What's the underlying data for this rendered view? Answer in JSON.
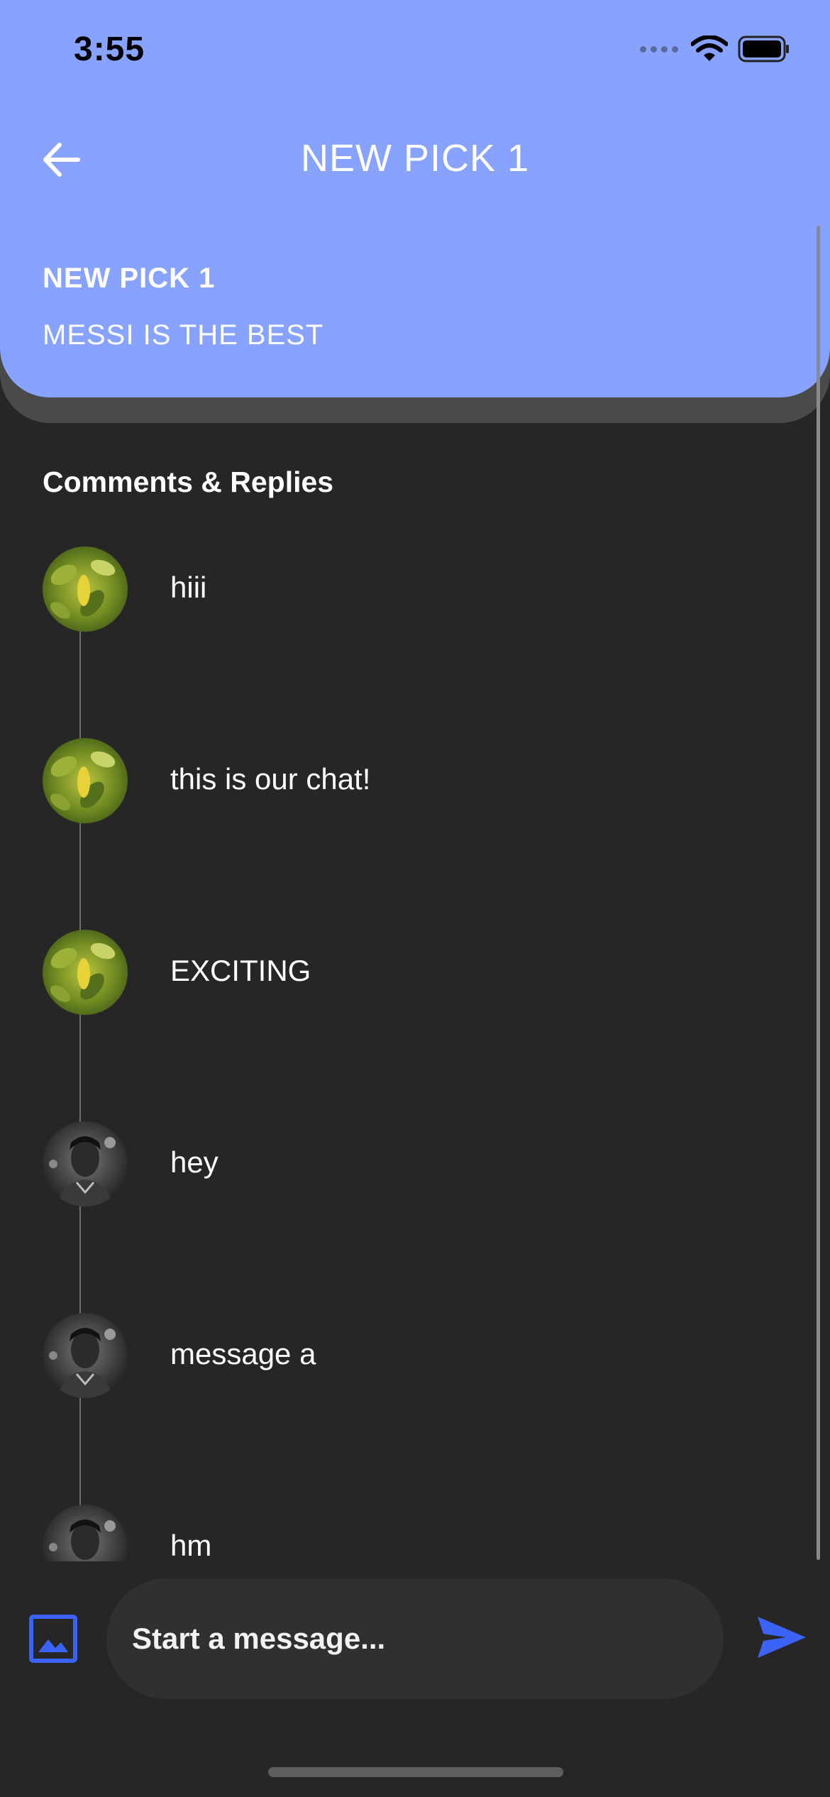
{
  "status_bar": {
    "time": "3:55"
  },
  "header": {
    "title": "NEW PICK 1",
    "pick_name": "NEW PICK 1",
    "pick_description": "MESSI IS THE BEST",
    "background_color": "#88a3ff"
  },
  "comments_section": {
    "title": "Comments & Replies",
    "comments": [
      {
        "text": "hiii",
        "avatar": "leaf-avatar"
      },
      {
        "text": "this is our chat!",
        "avatar": "leaf-avatar"
      },
      {
        "text": "EXCITING",
        "avatar": "leaf-avatar"
      },
      {
        "text": "hey",
        "avatar": "person-avatar"
      },
      {
        "text": "message a",
        "avatar": "person-avatar"
      },
      {
        "text": "hm",
        "avatar": "person-avatar"
      }
    ]
  },
  "composer": {
    "placeholder": "Start a message...",
    "image_icon": "image-icon",
    "send_icon": "send-icon",
    "accent_color": "#3b63f5"
  }
}
